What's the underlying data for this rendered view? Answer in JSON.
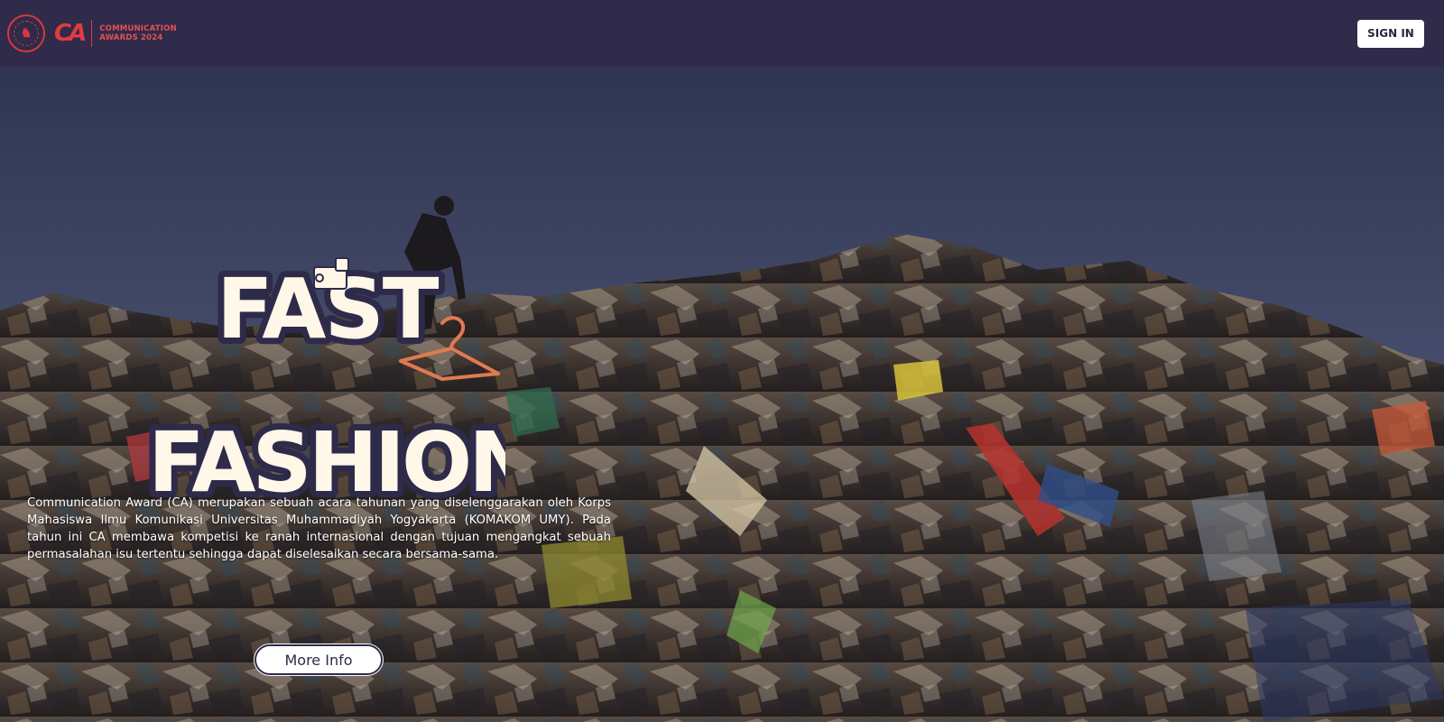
{
  "header": {
    "seal_glyph": "♞",
    "ca_mark": "CA",
    "ca_text_line1": "COMMUNICATION",
    "ca_text_line2": "AWARDS 2024",
    "signin_label": "SIGN IN"
  },
  "hero": {
    "title_line1": "FAST",
    "title_line2": "FASHION",
    "description": "Communication Award (CA) merupakan sebuah acara tahunan yang diselenggarakan oleh Korps Mahasiswa Ilmu Komunikasi Universitas Muhammadiyah Yogyakarta (KOMAKOM UMY). Pada tahun ini CA membawa kompetisi ke ranah internasional dengan tujuan mengangkat sebuah permasalahan isu tertentu sehingga dapat diselesaikan secara bersama-sama.",
    "more_info_label": "More Info"
  },
  "colors": {
    "header_bg": "#302a4b",
    "brand_red": "#e23b3f",
    "button_bg": "#ffffff",
    "button_text": "#2e2a49"
  }
}
